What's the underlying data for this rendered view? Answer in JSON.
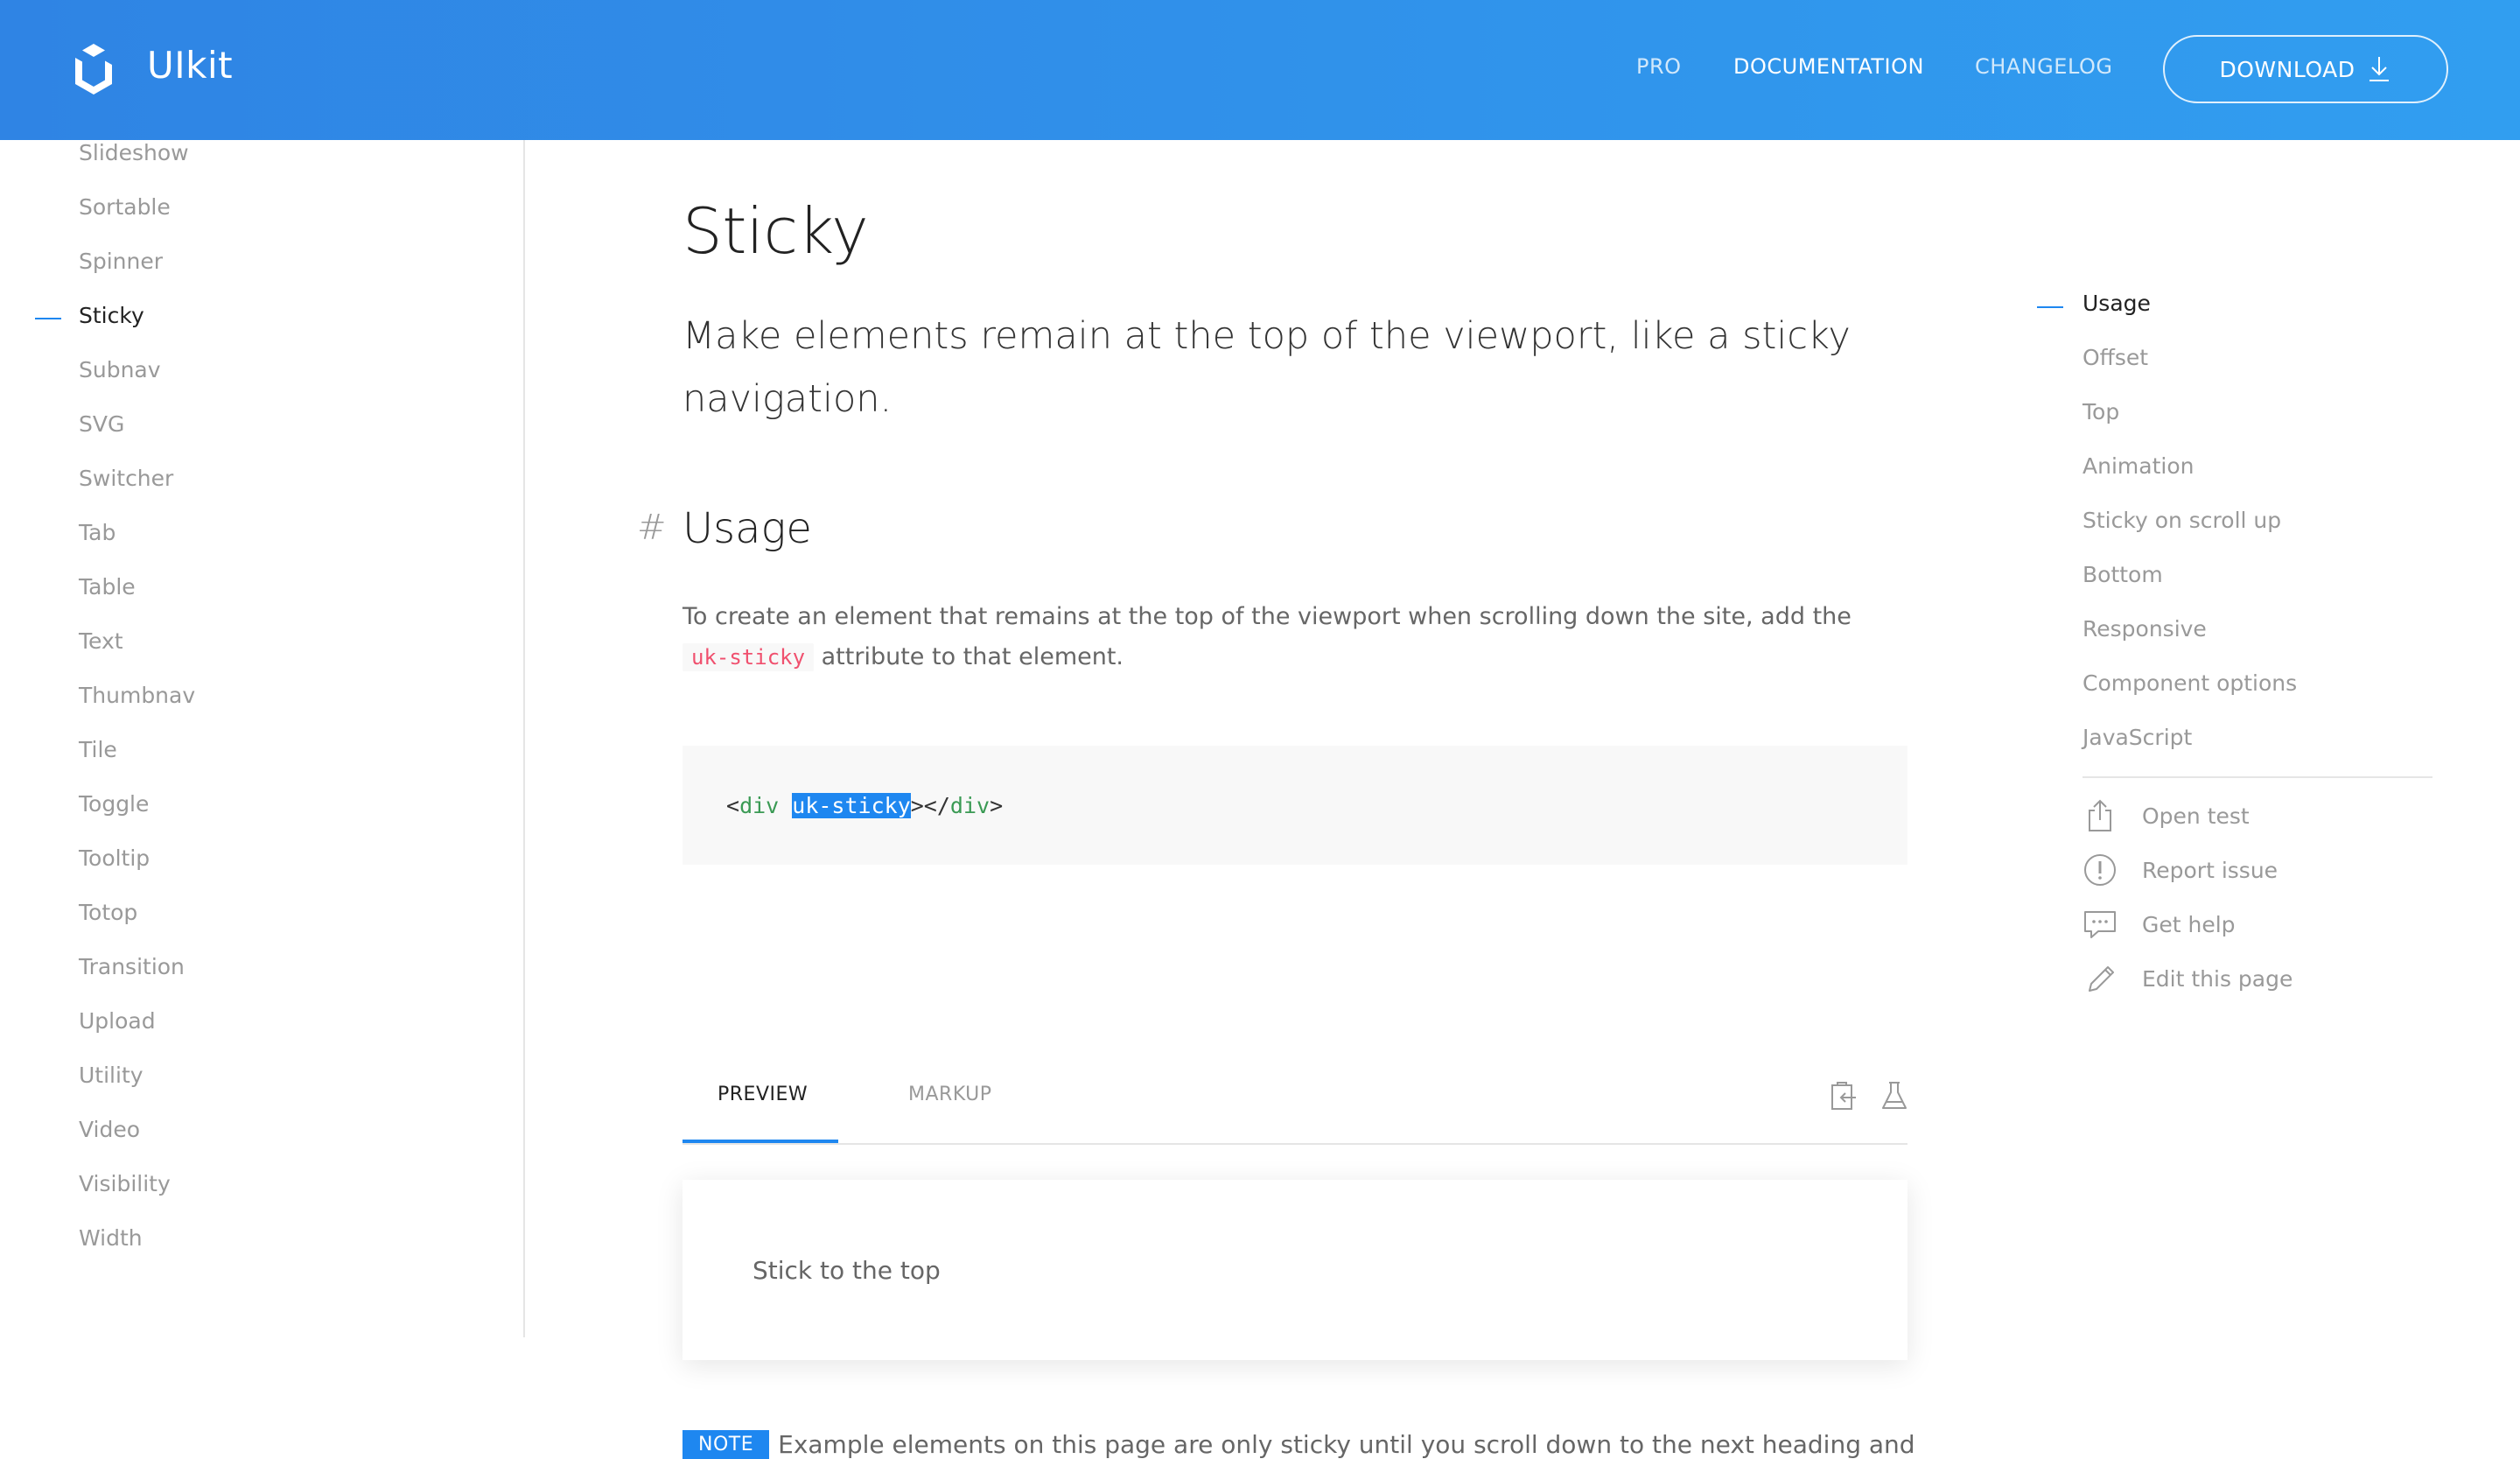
{
  "header": {
    "brand": "UIkit",
    "nav": [
      "PRO",
      "DOCUMENTATION",
      "CHANGELOG"
    ],
    "nav_active": "DOCUMENTATION",
    "download_label": "DOWNLOAD"
  },
  "sidebar": {
    "items": [
      "Slideshow",
      "Sortable",
      "Spinner",
      "Sticky",
      "Subnav",
      "SVG",
      "Switcher",
      "Tab",
      "Table",
      "Text",
      "Thumbnav",
      "Tile",
      "Toggle",
      "Tooltip",
      "Totop",
      "Transition",
      "Upload",
      "Utility",
      "Video",
      "Visibility",
      "Width"
    ],
    "active": "Sticky"
  },
  "main": {
    "title": "Sticky",
    "lead": "Make elements remain at the top of the viewport, like a sticky navigation.",
    "section_hash": "#",
    "section_heading": "Usage",
    "para_before": "To create an element that remains at the top of the viewport when scrolling down the site, add the",
    "para_code": "uk-sticky",
    "para_after": "attribute to that element.",
    "code": {
      "open_bracket": "<",
      "tag": "div",
      "attr": "uk-sticky",
      "mid": "></",
      "close_tag": "div",
      "close_bracket": ">"
    },
    "tabs": [
      "PREVIEW",
      "MARKUP"
    ],
    "active_tab": "PREVIEW",
    "preview_text": "Stick to the top",
    "note_badge": "NOTE",
    "note_text": "Example elements on this page are only sticky until you scroll down to the next heading and"
  },
  "toc": {
    "items": [
      "Usage",
      "Offset",
      "Top",
      "Animation",
      "Sticky on scroll up",
      "Bottom",
      "Responsive",
      "Component options",
      "JavaScript"
    ],
    "active": "Usage",
    "utilities": [
      {
        "label": "Open test",
        "icon": "share-icon"
      },
      {
        "label": "Report issue",
        "icon": "warning-icon"
      },
      {
        "label": "Get help",
        "icon": "comments-icon"
      },
      {
        "label": "Edit this page",
        "icon": "pencil-icon"
      }
    ]
  },
  "colors": {
    "primary": "#1e87f0",
    "header_start": "#2f84e4",
    "header_end": "#319ef0",
    "code_red": "#f0506e",
    "code_green": "#3a9a54"
  }
}
